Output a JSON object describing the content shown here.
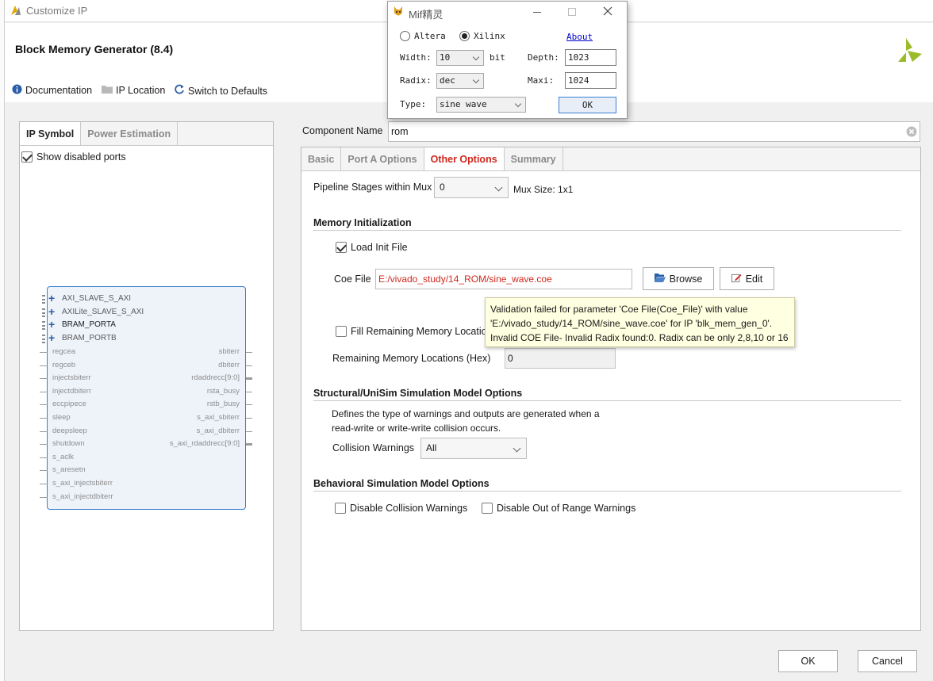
{
  "window": {
    "title": "Customize IP"
  },
  "header": {
    "title": "Block Memory Generator (8.4)"
  },
  "toolbar": {
    "documentation": "Documentation",
    "ip_location": "IP Location",
    "switch_defaults": "Switch to Defaults"
  },
  "left_panel": {
    "tabs": [
      "IP Symbol",
      "Power Estimation"
    ],
    "show_disabled": "Show disabled ports"
  },
  "symbol": {
    "buses": [
      "AXI_SLAVE_S_AXI",
      "AXILite_SLAVE_S_AXI",
      "BRAM_PORTA",
      "BRAM_PORTB"
    ],
    "left_pins": [
      "regcea",
      "regceb",
      "injectsbiterr",
      "injectdbiterr",
      "eccpipece",
      "sleep",
      "deepsleep",
      "shutdown",
      "s_aclk",
      "s_aresetn",
      "s_axi_injectsbiterr",
      "s_axi_injectdbiterr"
    ],
    "right_pins": [
      "sbiterr",
      "dbiterr",
      "rdaddrecc[9:0]",
      "rsta_busy",
      "rstb_busy",
      "s_axi_sbiterr",
      "s_axi_dbiterr",
      "s_axi_rdaddrecc[9:0]"
    ]
  },
  "component": {
    "label": "Component Name",
    "value": "rom"
  },
  "right_tabs": [
    "Basic",
    "Port A Options",
    "Other Options",
    "Summary"
  ],
  "pipeline": {
    "label": "Pipeline Stages within Mux",
    "value": "0",
    "mux_size": "Mux Size: 1x1"
  },
  "memory_init": {
    "title": "Memory Initialization",
    "load_init": "Load Init File",
    "coe_label": "Coe File",
    "coe_value": "E:/vivado_study/14_ROM/sine_wave.coe",
    "browse": "Browse",
    "edit": "Edit",
    "fill_remaining": "Fill Remaining Memory Locations",
    "remaining_label": "Remaining Memory Locations (Hex)",
    "remaining_value": "0"
  },
  "tooltip": {
    "line1": "Validation failed for parameter 'Coe File(Coe_File)' with value",
    "line2": "'E:/vivado_study/14_ROM/sine_wave.coe' for IP 'blk_mem_gen_0'.",
    "line3": "Invalid COE File- Invalid Radix found:0. Radix can be only 2,8,10 or 16"
  },
  "structural": {
    "title": "Structural/UniSim Simulation Model Options",
    "desc1": "Defines the type of warnings and outputs are generated when a",
    "desc2": "read-write or write-write collision occurs.",
    "collision_label": "Collision Warnings",
    "collision_value": "All"
  },
  "behavioral": {
    "title": "Behavioral Simulation Model Options",
    "disable_collision": "Disable Collision Warnings",
    "disable_out_of_range": "Disable Out of Range Warnings"
  },
  "footer": {
    "ok": "OK",
    "cancel": "Cancel"
  },
  "mif": {
    "title": "Mif精灵",
    "altera": "Altera",
    "xilinx": "Xilinx",
    "about": "About",
    "width_label": "Width:",
    "width_value": "10",
    "bit": "bit",
    "depth_label": "Depth:",
    "depth_value": "1023",
    "radix_label": "Radix:",
    "radix_value": "dec",
    "maxi_label": "Maxi:",
    "maxi_value": "1024",
    "type_label": "Type:",
    "type_value": "sine wave",
    "ok": "OK"
  },
  "colors": {
    "error_red": "#d0281e",
    "accent_blue": "#3b7fd0",
    "tooltip_bg": "#ffffe1"
  }
}
